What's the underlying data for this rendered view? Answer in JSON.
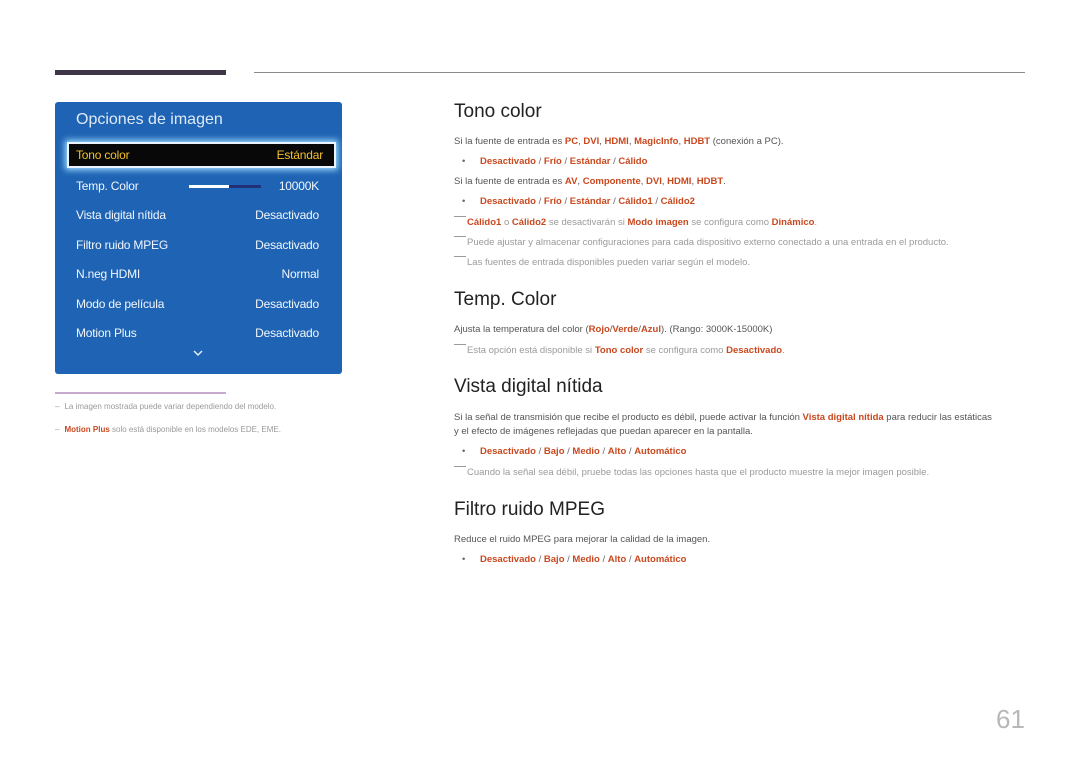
{
  "menu": {
    "title": "Opciones de imagen",
    "rows": [
      {
        "label": "Tono color",
        "value": "Estándar",
        "selected": true
      },
      {
        "label": "Temp. Color",
        "value": "10000K",
        "slider_fraction": 0.55
      },
      {
        "label": "Vista digital nítida",
        "value": "Desactivado"
      },
      {
        "label": "Filtro ruido MPEG",
        "value": "Desactivado"
      },
      {
        "label": "N.neg HDMI",
        "value": "Normal"
      },
      {
        "label": "Modo de película",
        "value": "Desactivado"
      },
      {
        "label": "Motion Plus",
        "value": "Desactivado"
      }
    ],
    "more_icon": "chevron-down-icon"
  },
  "left_notes": {
    "note1": "La imagen mostrada puede variar dependiendo del modelo.",
    "note2_hl": "Motion Plus",
    "note2_rest": " solo está disponible en los modelos EDE, EME."
  },
  "sections": {
    "tono": {
      "title": "Tono color",
      "p1_pre": "Si la fuente de entrada es ",
      "p1_items": [
        "PC",
        "DVI",
        "HDMI",
        "MagicInfo",
        "HDBT"
      ],
      "p1_post": " (conexión a PC).",
      "opts1": [
        "Desactivado",
        "Frío",
        "Estándar",
        "Cálido"
      ],
      "p2_pre": "Si la fuente de entrada es ",
      "p2_items": [
        "AV",
        "Componente",
        "DVI",
        "HDMI",
        "HDBT"
      ],
      "p2_post": ".",
      "opts2": [
        "Desactivado",
        "Frío",
        "Estándar",
        "Cálido1",
        "Cálido2"
      ],
      "n1": {
        "a": "Cálido1",
        "b": " o ",
        "c": "Cálido2",
        "d": " se desactivarán si ",
        "e": "Modo imagen",
        "f": " se configura como ",
        "g": "Dinámico",
        "h": "."
      },
      "n2": "Puede ajustar y almacenar configuraciones para cada dispositivo externo conectado a una entrada en el producto.",
      "n3": "Las fuentes de entrada disponibles pueden variar según el modelo."
    },
    "temp": {
      "title": "Temp. Color",
      "p_pre": "Ajusta la temperatura del color (",
      "p_a": "Rojo",
      "p_b": "Verde",
      "p_c": "Azul",
      "p_post": "). (Rango: 3000K-15000K)",
      "n1": {
        "a": "Esta opción está disponible si ",
        "b": "Tono color",
        "c": " se configura como ",
        "d": "Desactivado",
        "e": "."
      }
    },
    "vista": {
      "title": "Vista digital nítida",
      "p1_pre": "Si la señal de transmisión que recibe el producto es débil, puede activar la función ",
      "p1_hl": "Vista digital nítida",
      "p1_post": " para reducir las estáticas",
      "p2": "y el efecto de imágenes reflejadas que puedan aparecer en la pantalla.",
      "opts": [
        "Desactivado",
        "Bajo",
        "Medio",
        "Alto",
        "Automático"
      ],
      "n1": "Cuando la señal sea débil, pruebe todas las opciones hasta que el producto muestre la mejor imagen posible."
    },
    "filtro": {
      "title": "Filtro ruido MPEG",
      "p1": "Reduce el ruido MPEG para mejorar la calidad de la imagen.",
      "opts": [
        "Desactivado",
        "Bajo",
        "Medio",
        "Alto",
        "Automático"
      ]
    }
  },
  "page_number": "61"
}
